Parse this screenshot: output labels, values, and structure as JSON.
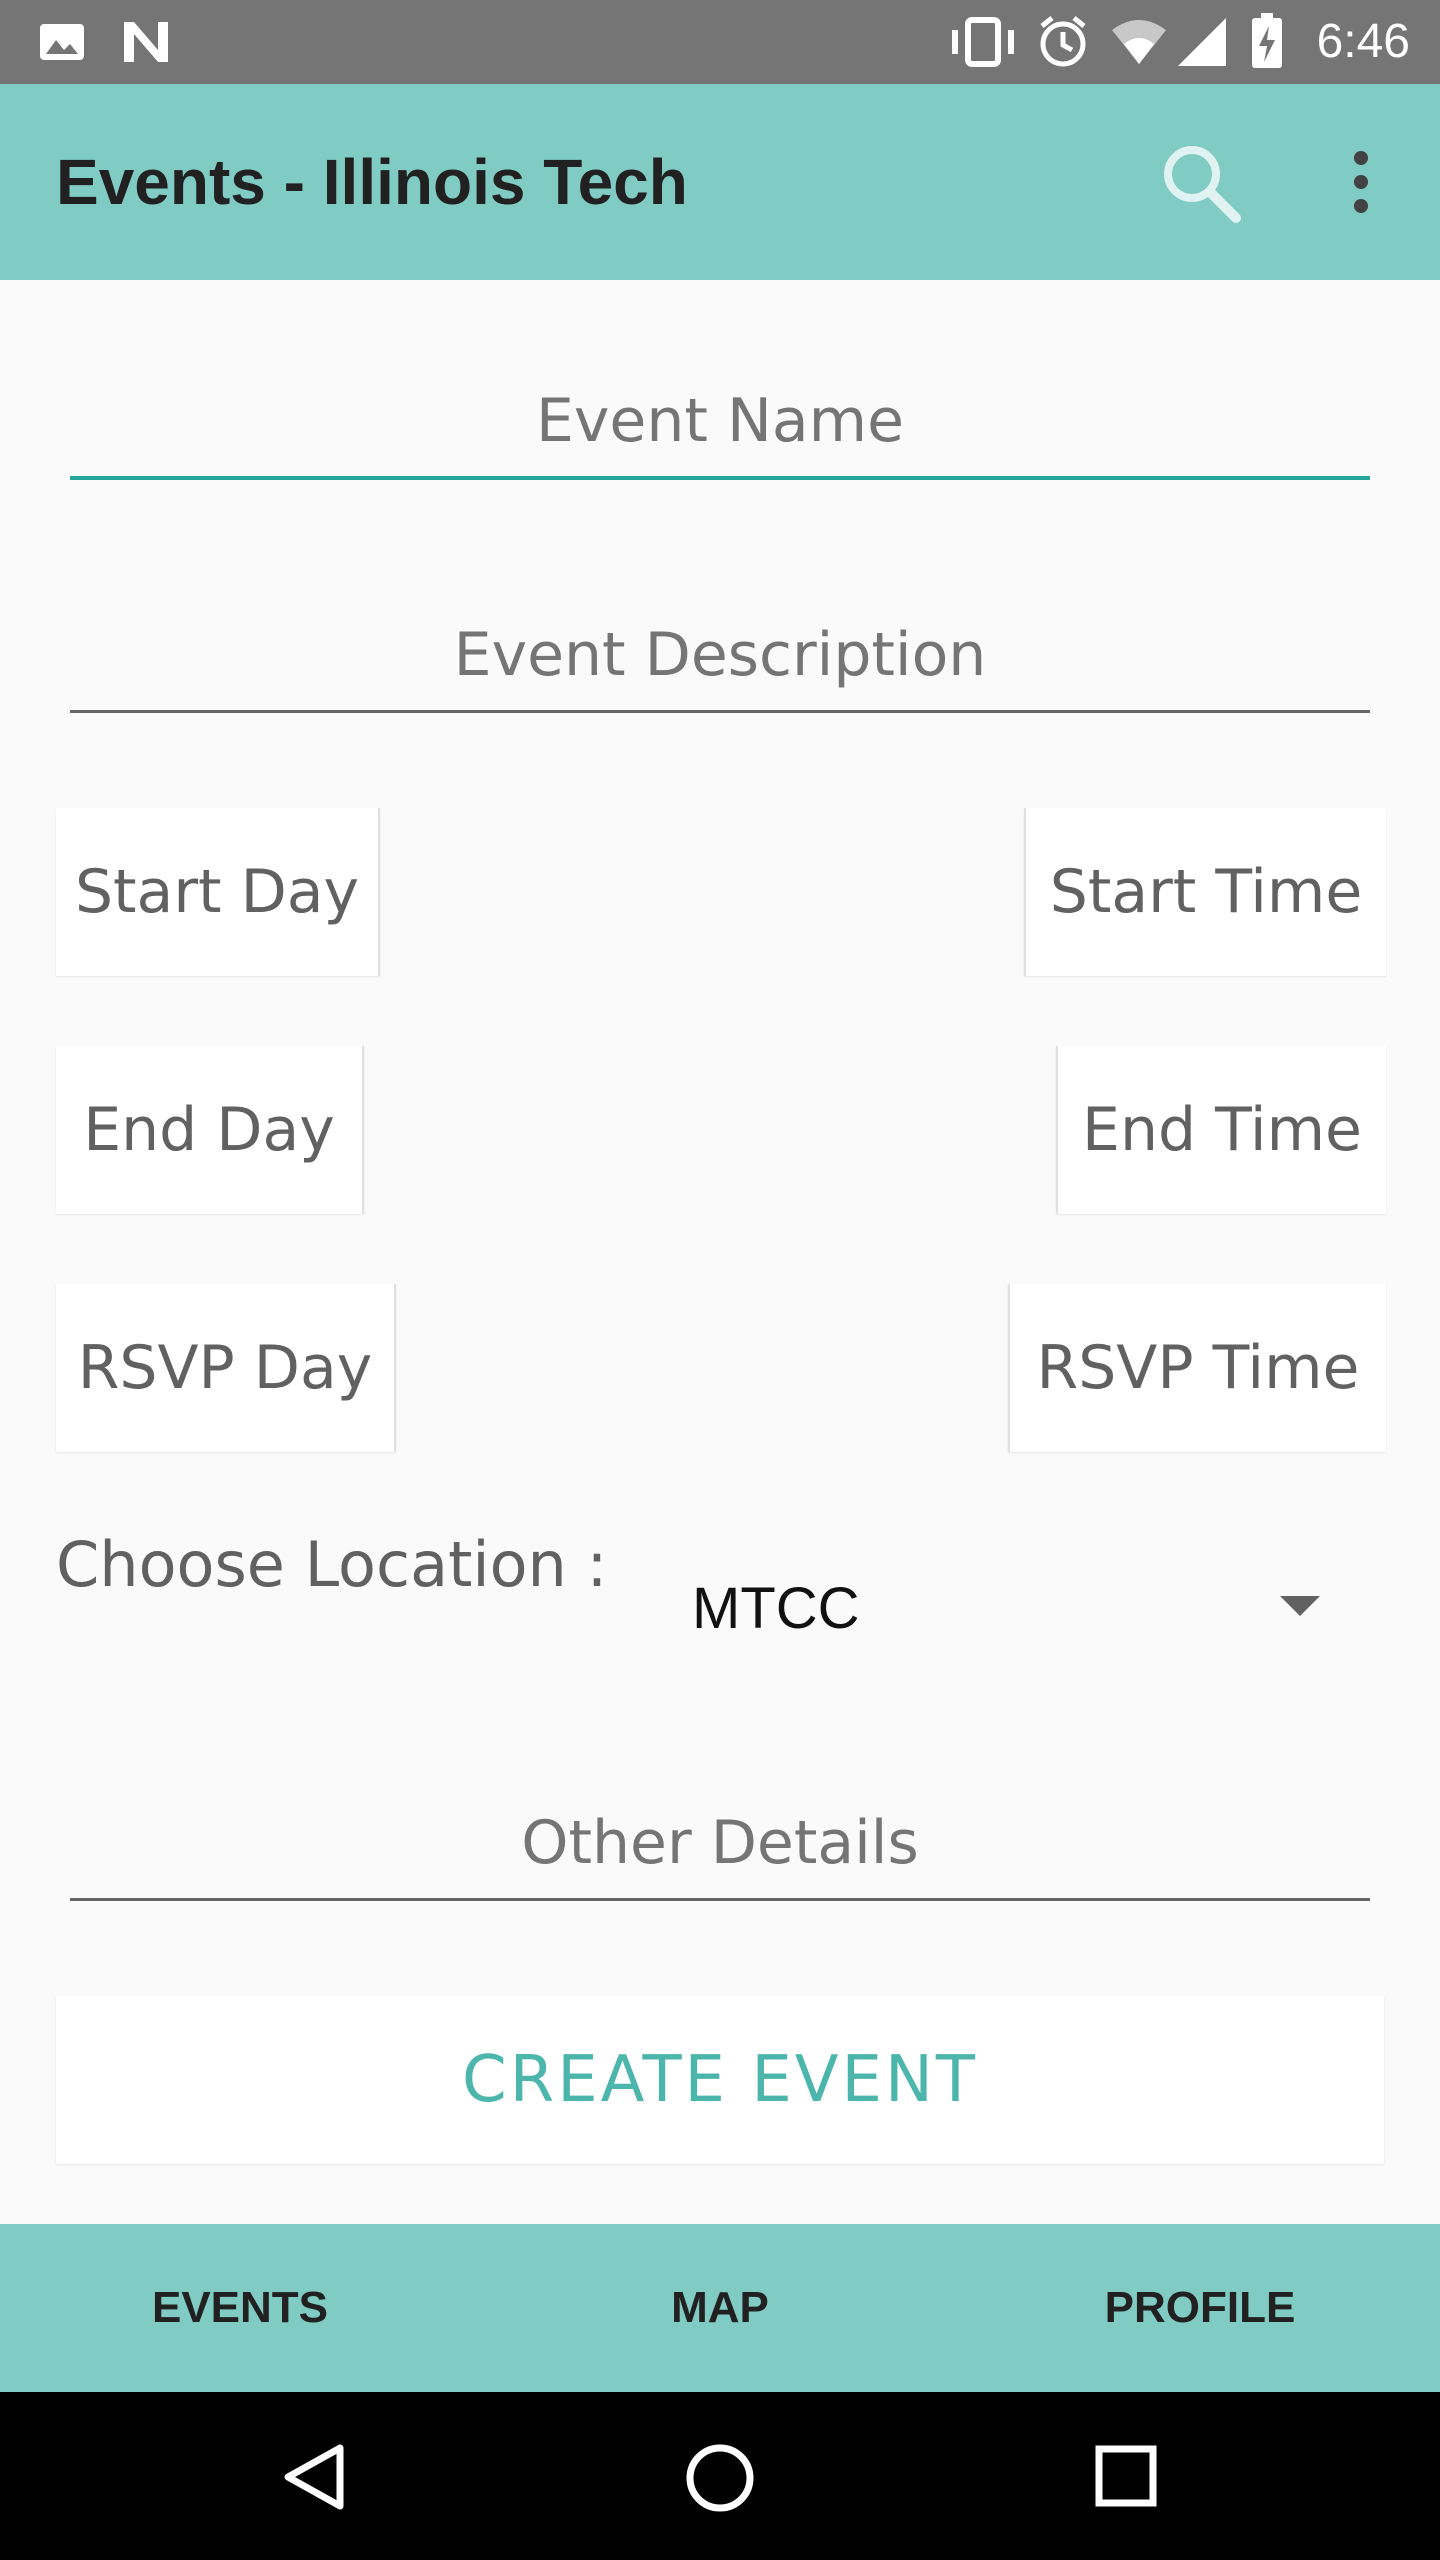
{
  "status_bar": {
    "time": "6:46"
  },
  "app_bar": {
    "title": "Events - Illinois Tech"
  },
  "form": {
    "event_name_placeholder": "Event Name",
    "event_description_placeholder": "Event Description",
    "start_day": "Start Day",
    "start_time": "Start Time",
    "end_day": "End Day",
    "end_time": "End Time",
    "rsvp_day": "RSVP Day",
    "rsvp_time": "RSVP Time",
    "location_label": "Choose Location :",
    "location_value": "MTCC",
    "other_details_placeholder": "Other Details",
    "create_button": "CREATE EVENT"
  },
  "bottom_nav": {
    "events": "EVENTS",
    "map": "MAP",
    "profile": "PROFILE"
  },
  "colors": {
    "app_bar": "#80cbc4",
    "accent": "#26a69a",
    "button_text": "#4db6ac",
    "status_bar": "#757575"
  }
}
